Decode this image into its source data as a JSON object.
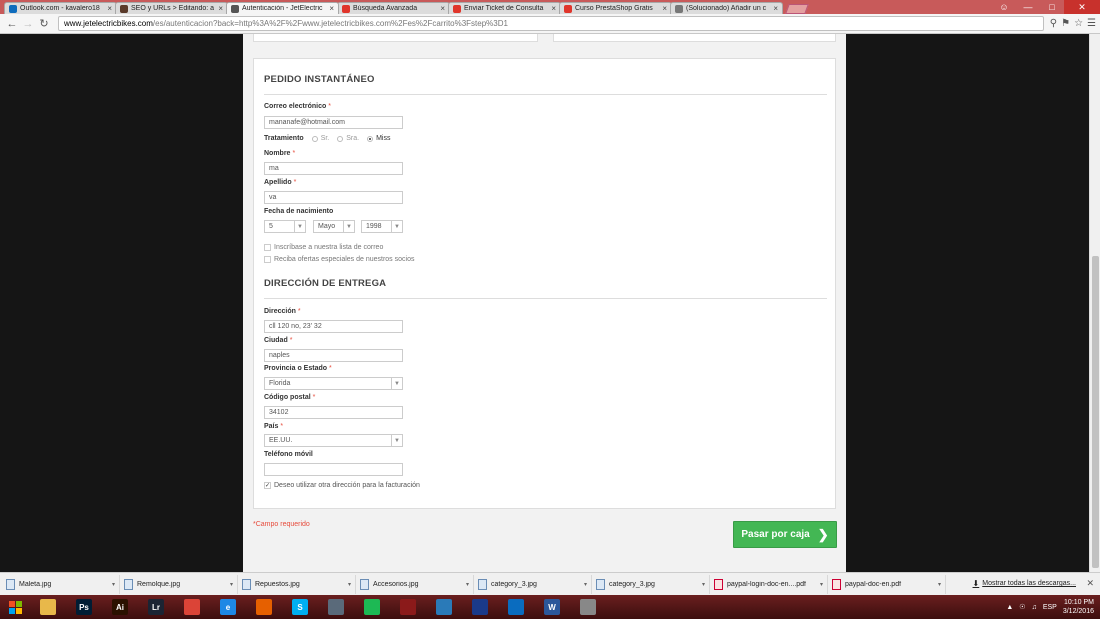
{
  "tabs": [
    {
      "title": "Outlook.com - kavalero18",
      "fav": "mail-icon",
      "color": "#0f6cbd",
      "active": false
    },
    {
      "title": "SEO y URLs > Editando: a",
      "fav": "prestashop-icon",
      "color": "#5a3a2a",
      "active": false
    },
    {
      "title": "Autenticación - JetElectric",
      "fav": "globe-icon",
      "color": "#555555",
      "active": true
    },
    {
      "title": "Búsqueda Avanzada",
      "fav": "udemy-icon",
      "color": "#e0352b",
      "active": false
    },
    {
      "title": "Enviar Ticket de Consulta",
      "fav": "udemy-icon",
      "color": "#e0352b",
      "active": false
    },
    {
      "title": "Curso PrestaShop Gratis",
      "fav": "udemy-icon",
      "color": "#e0352b",
      "active": false
    },
    {
      "title": "(Solucionado) Añadir un c",
      "fav": "forum-icon",
      "color": "#777777",
      "active": false
    }
  ],
  "address": {
    "host": "www.jetelectricbikes.com",
    "rest": "/es/autenticacion?back=http%3A%2F%2Fwww.jetelectricbikes.com%2Fes%2Fcarrito%3Fstep%3D1"
  },
  "form": {
    "section1_title": "PEDIDO INSTANTÁNEO",
    "email_label": "Correo electrónico",
    "email_value": "mananafe@hotmail.com",
    "title_label": "Tratamiento",
    "title_options": [
      "Sr.",
      "Sra.",
      "Miss"
    ],
    "title_selected": "Miss",
    "firstname_label": "Nombre",
    "firstname_value": "ma",
    "lastname_label": "Apellido",
    "lastname_value": "va",
    "birth_label": "Fecha de nacimiento",
    "birth_day": "5",
    "birth_month": "Mayo",
    "birth_year": "1998",
    "newsletter_label": "Inscríbase a nuestra lista de correo",
    "optin_label": "Reciba ofertas especiales de nuestros socios",
    "section2_title": "DIRECCIÓN DE ENTREGA",
    "address_label": "Dirección",
    "address_value": "cll 120 no, 23' 32",
    "city_label": "Ciudad",
    "city_value": "naples",
    "state_label": "Provincia o Estado",
    "state_value": "Florida",
    "postcode_label": "Código postal",
    "postcode_value": "34102",
    "country_label": "País",
    "country_value": "EE.UU.",
    "phone_label": "Teléfono móvil",
    "phone_value": "",
    "invoice_label": "Deseo utilizar otra dirección para la facturación",
    "invoice_checked": true,
    "required_marker": "*",
    "required_note": "*Campo requerido",
    "submit_label": "Pasar por caja"
  },
  "downloads": {
    "items": [
      {
        "name": "Maleta.jpg",
        "type": "image"
      },
      {
        "name": "Remolque.jpg",
        "type": "image"
      },
      {
        "name": "Repuestos.jpg",
        "type": "image"
      },
      {
        "name": "Accesorios.jpg",
        "type": "image"
      },
      {
        "name": "category_3.jpg",
        "type": "image"
      },
      {
        "name": "category_3.jpg",
        "type": "image"
      },
      {
        "name": "paypal-login-doc-en....pdf",
        "type": "pdf"
      },
      {
        "name": "paypal-doc-en.pdf",
        "type": "pdf"
      }
    ],
    "show_all": "Mostrar todas las descargas..."
  },
  "taskbar": {
    "apps": [
      {
        "name": "file-explorer-icon",
        "label": "",
        "color": "#e8b84a"
      },
      {
        "name": "photoshop-icon",
        "label": "Ps",
        "color": "#001d34"
      },
      {
        "name": "illustrator-icon",
        "label": "Ai",
        "color": "#2b1100"
      },
      {
        "name": "lightroom-icon",
        "label": "Lr",
        "color": "#1b2433"
      },
      {
        "name": "chrome-icon",
        "label": "",
        "color": "#db4437"
      },
      {
        "name": "ie-icon",
        "label": "e",
        "color": "#1e88e5"
      },
      {
        "name": "firefox-icon",
        "label": "",
        "color": "#e66000"
      },
      {
        "name": "skype-icon",
        "label": "S",
        "color": "#00aff0"
      },
      {
        "name": "device-icon",
        "label": "",
        "color": "#5a6a7a"
      },
      {
        "name": "spotify-icon",
        "label": "",
        "color": "#1db954"
      },
      {
        "name": "app-icon",
        "label": "",
        "color": "#8b1a1a"
      },
      {
        "name": "target-icon",
        "label": "",
        "color": "#2a7ab8"
      },
      {
        "name": "crown-icon",
        "label": "",
        "color": "#1a3a8a"
      },
      {
        "name": "sync-icon",
        "label": "",
        "color": "#0a6cbf"
      },
      {
        "name": "word-icon",
        "label": "W",
        "color": "#2b579a"
      },
      {
        "name": "network-icon",
        "label": "",
        "color": "#888888"
      }
    ],
    "lang": "ESP",
    "time": "10:10 PM",
    "date": "3/12/2016"
  }
}
